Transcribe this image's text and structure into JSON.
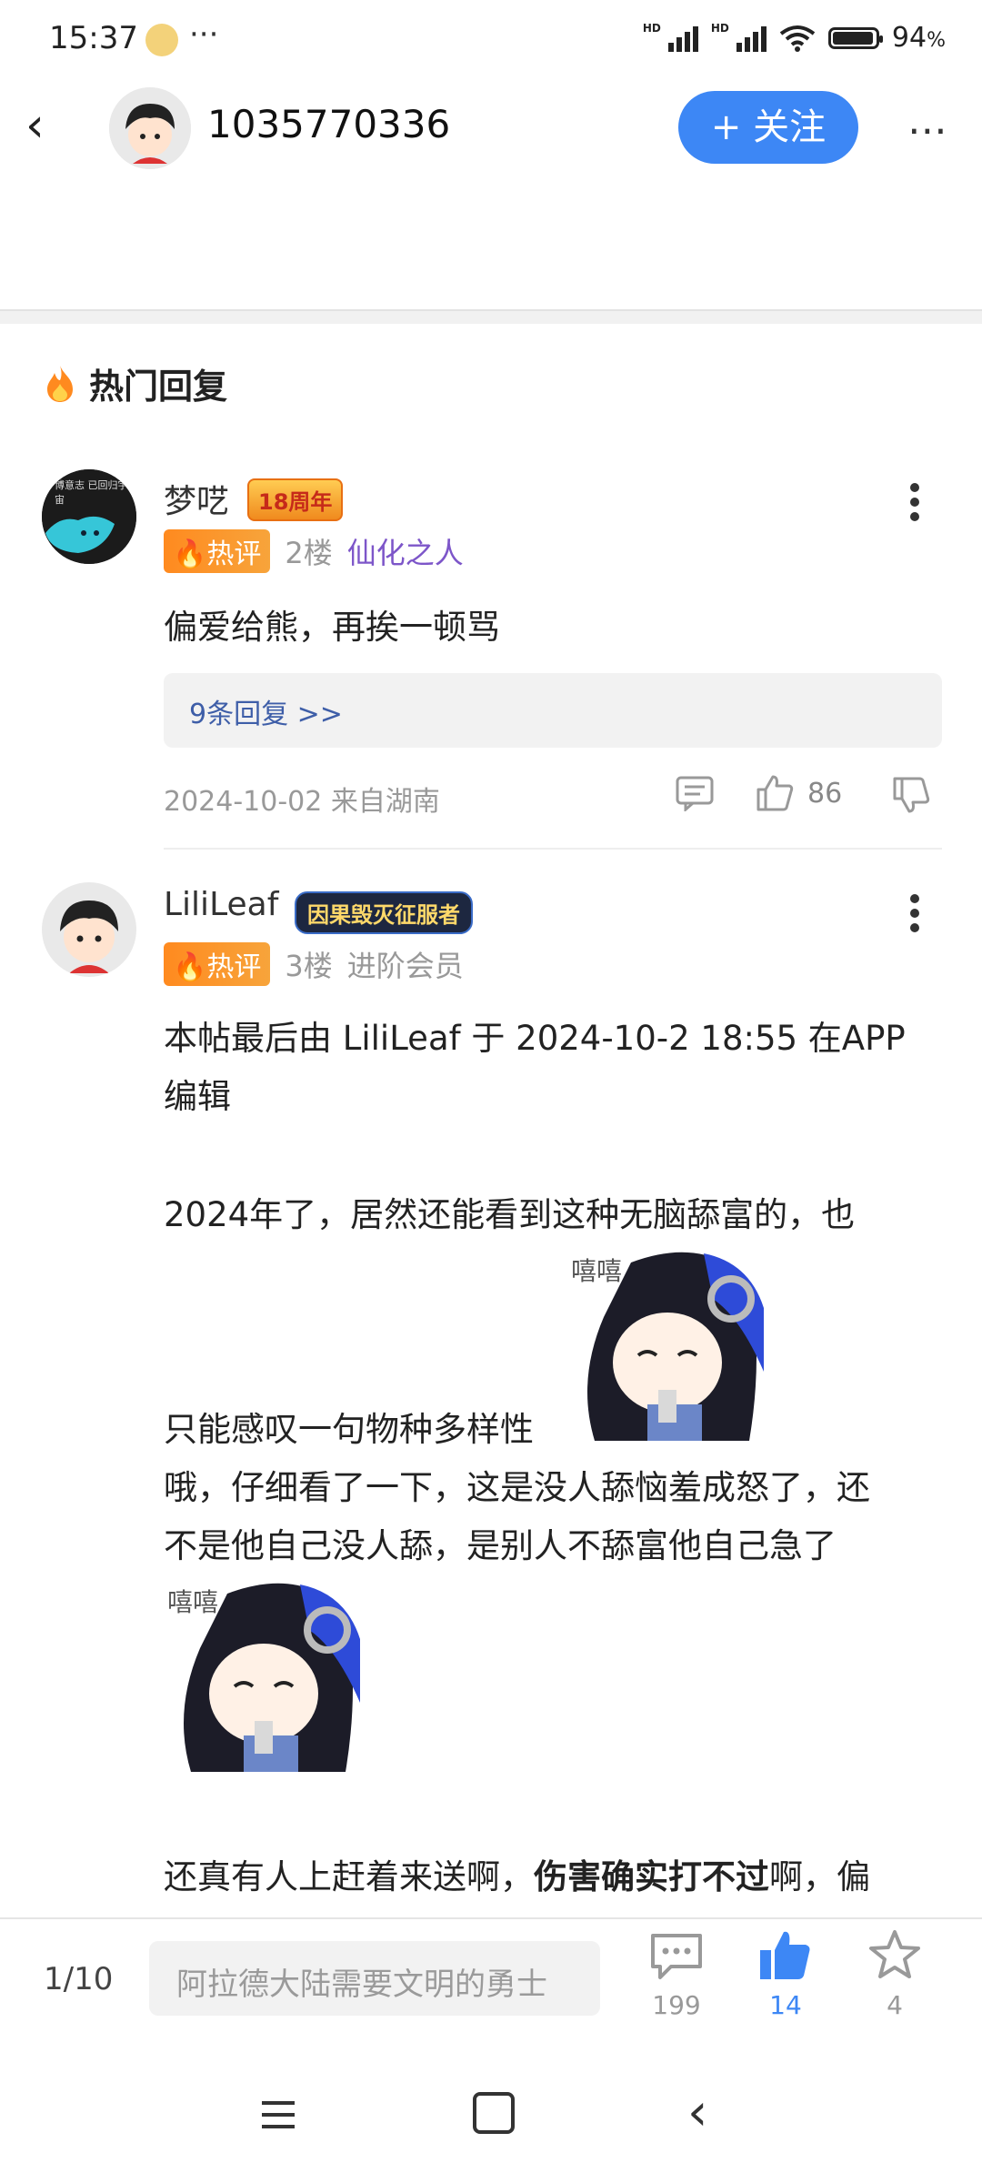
{
  "status": {
    "time": "15:37",
    "battery": "94",
    "battery_unit": "%",
    "hd1": "HD",
    "hd2": "HD"
  },
  "header": {
    "back": "‹",
    "username": "1035770336",
    "follow_label": "+ 关注",
    "more": "⋯"
  },
  "hot": {
    "title": "热门回复"
  },
  "comments": [
    {
      "name": "梦呓",
      "medal": "18周年",
      "avatar_text": "博意志 已回归宇宙",
      "hot_badge": "热评",
      "floor": "2楼",
      "title": "仙化之人",
      "text": "偏爱给熊，再挨一顿骂",
      "replies": "9条回复 >>",
      "meta": "2024-10-02 来自湖南",
      "likes": "86"
    },
    {
      "name": "LiliLeaf",
      "medal": "因果毁灭征服者",
      "hot_badge": "热评",
      "floor": "3楼",
      "title": "进阶会员",
      "lines": [
        "本帖最后由 LiliLeaf 于 2024-10-2 18:55 在APP",
        "编辑",
        "2024年了，居然还能看到这种无脑舔富的，也",
        "只能感叹一句物种多样性",
        "哦，仔细看了一下，这是没人舔恼羞成怒了，还",
        "不是他自己没人舔，是别人不舔富他自己急了",
        "还真有人上赶着来送啊，"
      ],
      "bold_text": "伤害确实打不过",
      "after_bold": "啊，偏",
      "sticker_label": "嘻嘻"
    }
  ],
  "bottom": {
    "page": "1/10",
    "input_placeholder": "阿拉德大陆需要文明的勇士",
    "comments_count": "199",
    "likes_count": "14",
    "fav_count": "4"
  },
  "colors": {
    "accent": "#3d87f5",
    "hot": "#ff8a1f",
    "purple_title": "#7d56c9"
  }
}
